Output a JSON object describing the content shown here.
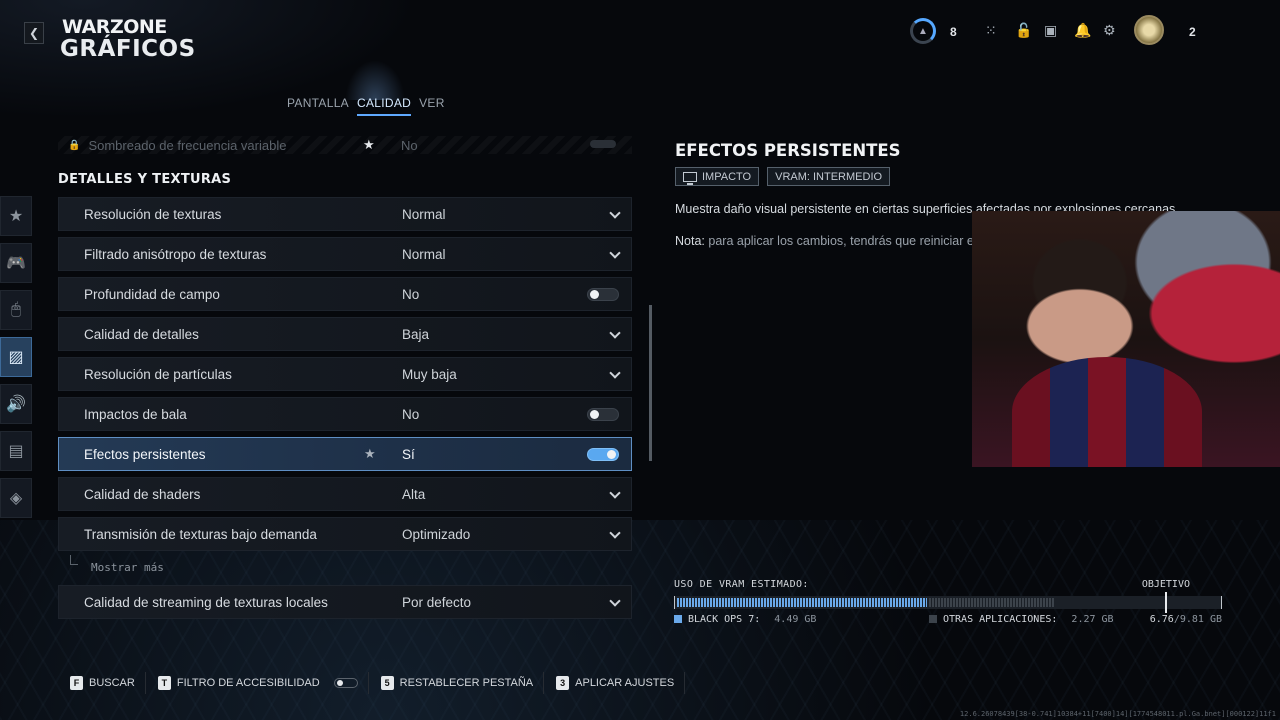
{
  "header": {
    "game": "WARZONE",
    "title": "GRÁFICOS"
  },
  "tabs": [
    {
      "label": "PANTALLA",
      "active": false
    },
    {
      "label": "CALIDAD",
      "active": true
    },
    {
      "label": "VER",
      "active": false
    }
  ],
  "topbar": {
    "level": "8",
    "friends_count": "2",
    "icons": [
      "rank-ring-icon",
      "apps-grid-icon",
      "lock-icon",
      "store-icon",
      "notification-icon",
      "gear-icon",
      "avatar"
    ]
  },
  "sidebar": {
    "items": [
      {
        "icon": "star-icon",
        "glyph": "★",
        "active": false
      },
      {
        "icon": "gamepad-icon",
        "glyph": "🎮",
        "active": false
      },
      {
        "icon": "mouse-icon",
        "glyph": "🖱",
        "active": false
      },
      {
        "icon": "graphics-icon",
        "glyph": "▨",
        "active": true
      },
      {
        "icon": "speaker-icon",
        "glyph": "🔊",
        "active": false
      },
      {
        "icon": "interface-icon",
        "glyph": "▤",
        "active": false
      },
      {
        "icon": "network-icon",
        "glyph": "◈",
        "active": false
      }
    ]
  },
  "settings": {
    "faded_row": {
      "label": "Sombreado de frecuencia variable",
      "value": "No"
    },
    "section_title": "DETALLES Y TEXTURAS",
    "rows": [
      {
        "label": "Resolución de texturas",
        "value": "Normal",
        "control": "dropdown",
        "star": false,
        "selected": false
      },
      {
        "label": "Filtrado anisótropo de texturas",
        "value": "Normal",
        "control": "dropdown",
        "star": false,
        "selected": false
      },
      {
        "label": "Profundidad de campo",
        "value": "No",
        "control": "toggle",
        "on": false,
        "star": false,
        "selected": false
      },
      {
        "label": "Calidad de detalles",
        "value": "Baja",
        "control": "dropdown",
        "star": false,
        "selected": false
      },
      {
        "label": "Resolución de partículas",
        "value": "Muy baja",
        "control": "dropdown",
        "star": false,
        "selected": false
      },
      {
        "label": "Impactos de bala",
        "value": "No",
        "control": "toggle",
        "on": false,
        "star": false,
        "selected": false
      },
      {
        "label": "Efectos persistentes",
        "value": "Sí",
        "control": "toggle",
        "on": true,
        "star": true,
        "selected": true
      },
      {
        "label": "Calidad de shaders",
        "value": "Alta",
        "control": "dropdown",
        "star": false,
        "selected": false
      },
      {
        "label": "Transmisión de texturas bajo demanda",
        "value": "Optimizado",
        "control": "dropdown",
        "star": false,
        "selected": false
      }
    ],
    "show_more": "Mostrar más",
    "after_rows": [
      {
        "label": "Calidad de streaming de texturas locales",
        "value": "Por defecto",
        "control": "dropdown",
        "star": false,
        "selected": false
      }
    ]
  },
  "detail": {
    "title": "EFECTOS PERSISTENTES",
    "badge_impact": "IMPACTO",
    "badge_vram": "VRAM: INTERMEDIO",
    "description": "Muestra daño visual persistente en ciertas superficies afectadas por explosiones cercanas.",
    "note_label": "Nota:",
    "note_text": "para aplicar los cambios, tendrás que reiniciar el"
  },
  "vram": {
    "label": "USO DE VRAM ESTIMADO:",
    "target_label": "OBJETIVO",
    "game_label": "BLACK OPS 7:",
    "game_value": "4.49 GB",
    "other_label": "OTRAS APLICACIONES:",
    "other_value": "2.27 GB",
    "total_used": "6.76",
    "total_sep": "/",
    "total_available": "9.81 GB",
    "game_gb": 4.49,
    "other_gb": 2.27,
    "total_gb": 9.81,
    "target_gb": 8.8,
    "game_color": "#6aa9ea",
    "other_color": "#3c434b"
  },
  "footer": [
    {
      "key": "F",
      "label": "BUSCAR"
    },
    {
      "key": "T",
      "label": "FILTRO DE ACCESIBILIDAD",
      "toggle": true
    },
    {
      "key": "5",
      "label": "RESTABLECER PESTAÑA"
    },
    {
      "key": "3",
      "label": "APLICAR AJUSTES"
    }
  ],
  "version": "12.6.26078439[38-0.741]10384+11[7400]14][1774548011.pl.Ga.bnet][000122]11f1"
}
